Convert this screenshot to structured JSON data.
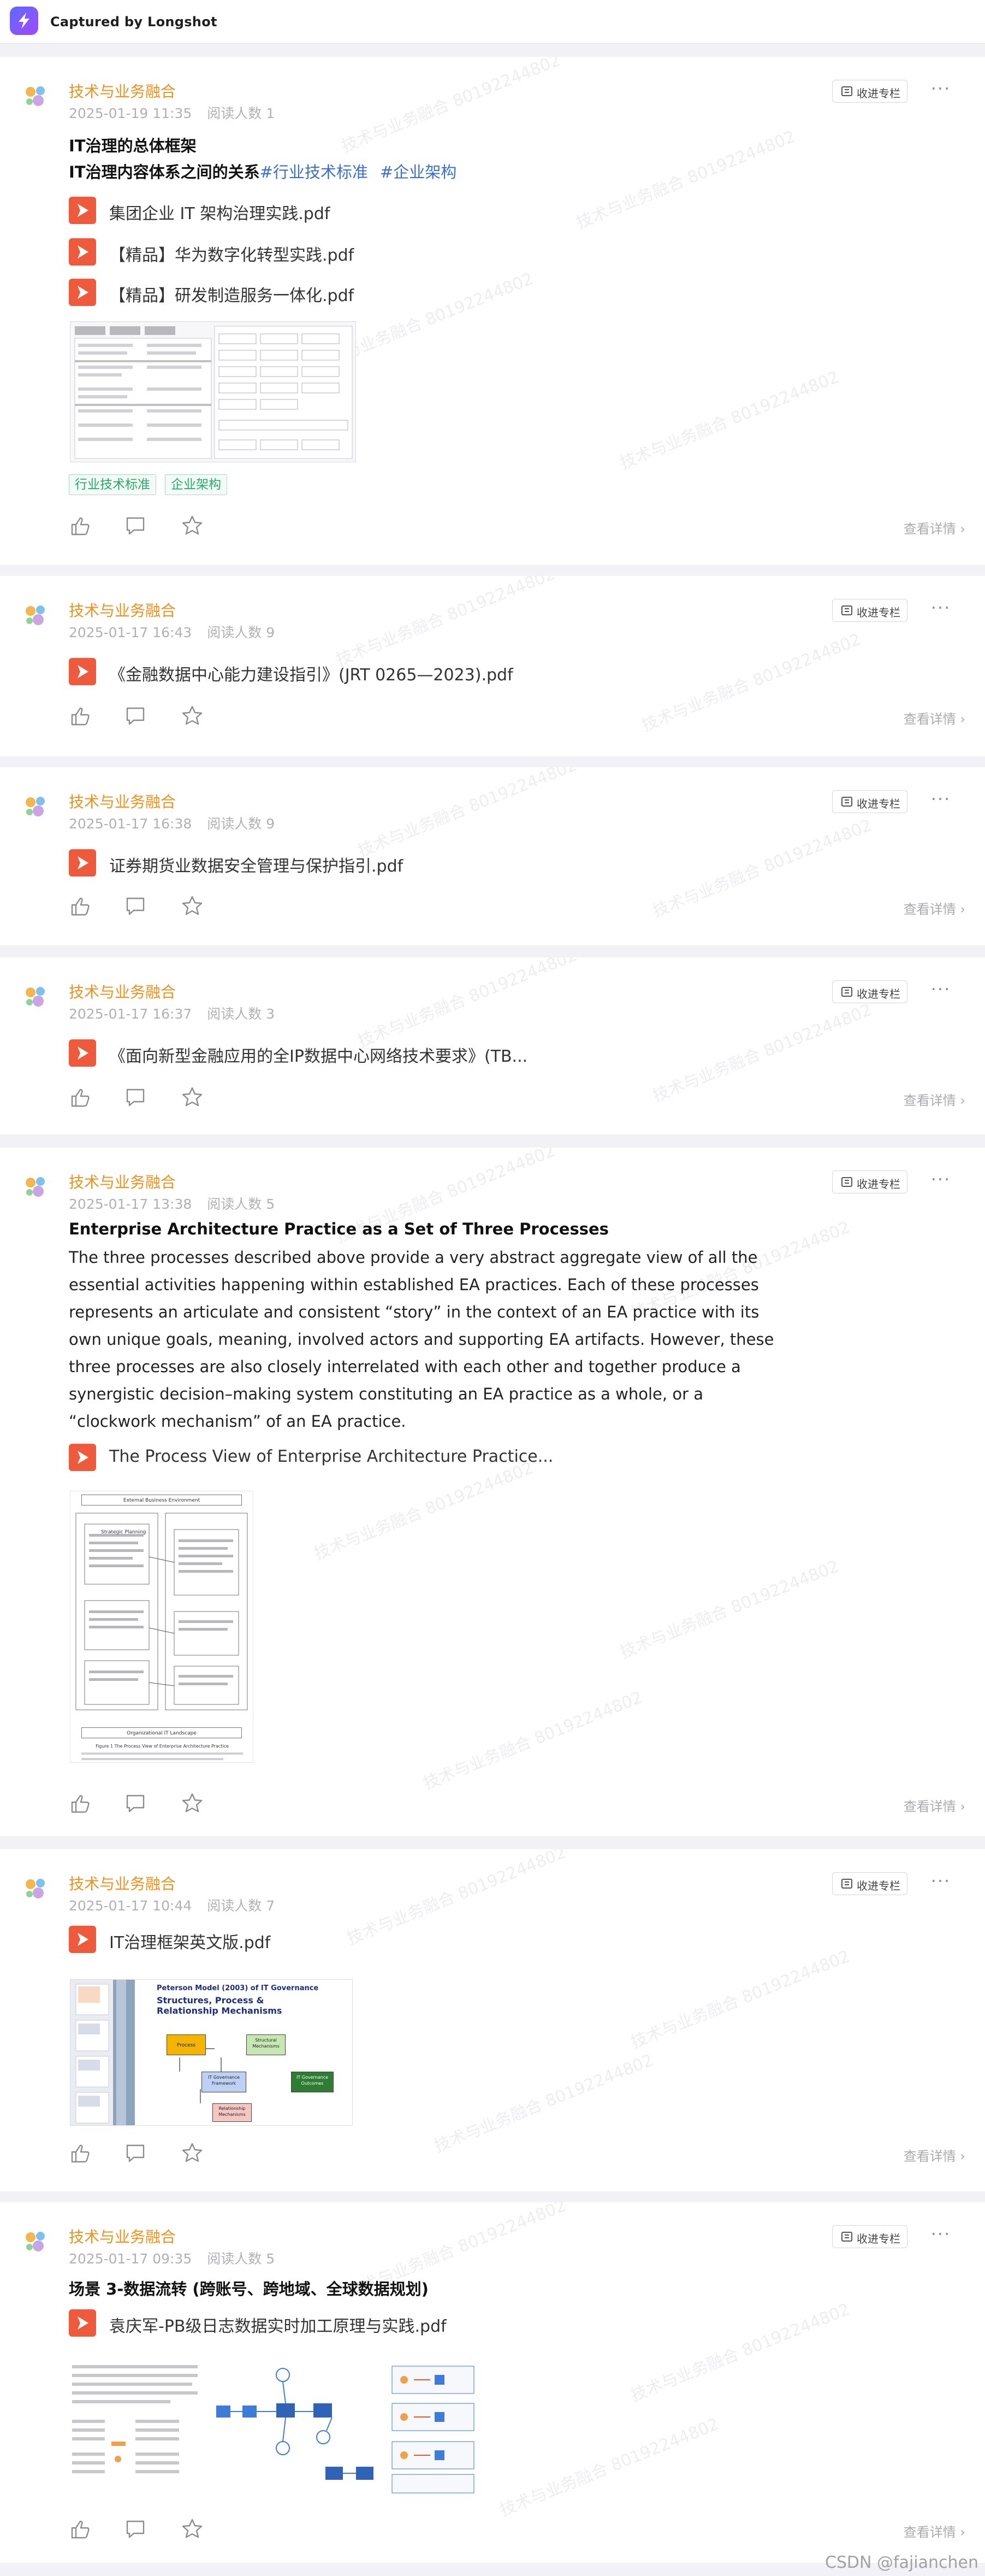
{
  "app": {
    "title": "Captured by Longshot",
    "footer": "CSDN @fajianchen"
  },
  "labels": {
    "collect": "收进专栏",
    "more": "···",
    "detail": "查看详情 ›",
    "watermark": "技术与业务融合 80192244802"
  },
  "colors": {
    "author": "#f0911e",
    "pdf": "#ef5a3c",
    "hashtag": "#3b6fc9",
    "tag": "#2aa66e"
  },
  "posts": [
    {
      "author": "技术与业务融合",
      "date": "2025-01-19 11:35",
      "readers": "阅读人数 1",
      "title": "IT治理的总体框架",
      "line2": "IT治理内容体系之间的关系",
      "hashtags": [
        "#行业技术标准",
        "#企业架构"
      ],
      "files": [
        "集团企业 IT 架构治理实践.pdf",
        "【精品】华为数字化转型实践.pdf",
        "【精品】研发制造服务一体化.pdf"
      ],
      "tags": [
        "行业技术标准",
        "企业架构"
      ]
    },
    {
      "author": "技术与业务融合",
      "date": "2025-01-17 16:43",
      "readers": "阅读人数 9",
      "files": [
        "《金融数据中心能力建设指引》(JRT 0265—2023).pdf"
      ]
    },
    {
      "author": "技术与业务融合",
      "date": "2025-01-17 16:38",
      "readers": "阅读人数 9",
      "files": [
        "证券期货业数据安全管理与保护指引.pdf"
      ]
    },
    {
      "author": "技术与业务融合",
      "date": "2025-01-17 16:37",
      "readers": "阅读人数 3",
      "files": [
        "《面向新型金融应用的全IP数据中心网络技术要求》(TB..."
      ]
    },
    {
      "author": "技术与业务融合",
      "date": "2025-01-17 13:38",
      "readers": "阅读人数 5",
      "title": "Enterprise Architecture Practice as a Set of Three Processes",
      "body": "The three processes described above provide a very abstract aggregate view of all the essential activities happening within established EA practices. Each of these processes represents an articulate and consistent “story” in the context of an EA practice with its own unique goals, meaning, involved actors and supporting EA artifacts. However, these three processes are also closely interrelated with each other and together produce a synergistic decision–making system constituting an EA practice as a whole, or a “clockwork mechanism” of an EA practice.",
      "files": [
        "The Process View of Enterprise Architecture Practice..."
      ],
      "figure": {
        "top": "External Business Environment",
        "left": "Strategic Planning",
        "bottom": "Organizational IT Landscape",
        "caption": "Figure 1 The Process View of Enterprise Architecture Practice"
      }
    },
    {
      "author": "技术与业务融合",
      "date": "2025-01-17 10:44",
      "readers": "阅读人数 7",
      "files": [
        "IT治理框架英文版.pdf"
      ],
      "figure": {
        "heading": "Peterson Model (2003) of IT Governance",
        "subheading": "Structures, Process & Relationship Mechanisms",
        "boxes": [
          "Process",
          "Structural Mechanisms",
          "IT Governance Framework",
          "IT Governance Outcomes",
          "Relationship Mechanisms"
        ]
      }
    },
    {
      "author": "技术与业务融合",
      "date": "2025-01-17 09:35",
      "readers": "阅读人数 5",
      "title": "场景 3-数据流转 (跨账号、跨地域、全球数据规划)",
      "files": [
        "袁庆军-PB级日志数据实时加工原理与实践.pdf"
      ]
    }
  ]
}
